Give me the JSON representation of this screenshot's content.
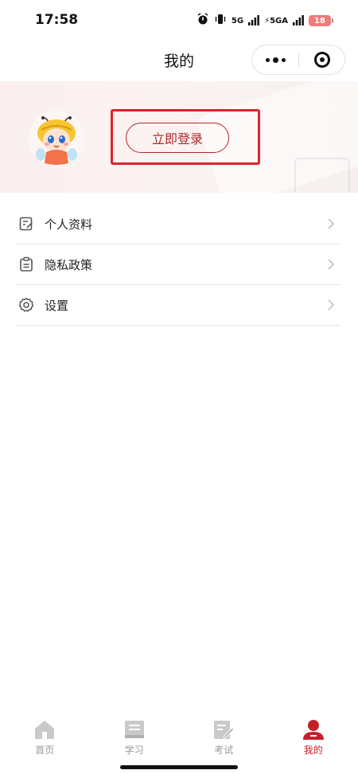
{
  "status_bar": {
    "time": "17:58",
    "signal_1": "5G",
    "signal_2": "⚡5GA",
    "battery": "18",
    "icons": [
      "alarm-icon",
      "vibrate-icon",
      "signal-5g-icon",
      "signal-5ga-icon",
      "battery-icon"
    ]
  },
  "nav": {
    "title": "我的"
  },
  "profile": {
    "login_label": "立即登录"
  },
  "menu": {
    "items": [
      {
        "label": "个人资料",
        "icon": "edit-doc-icon"
      },
      {
        "label": "隐私政策",
        "icon": "clipboard-icon"
      },
      {
        "label": "设置",
        "icon": "gear-icon"
      }
    ]
  },
  "tabbar": {
    "items": [
      {
        "label": "首页",
        "icon": "home-icon",
        "active": false
      },
      {
        "label": "学习",
        "icon": "book-icon",
        "active": false
      },
      {
        "label": "考试",
        "icon": "exam-edit-icon",
        "active": false
      },
      {
        "label": "我的",
        "icon": "user-icon",
        "active": true
      }
    ]
  },
  "colors": {
    "accent": "#c4202b",
    "highlight_border": "#e0222a",
    "inactive_tab": "#999999"
  }
}
